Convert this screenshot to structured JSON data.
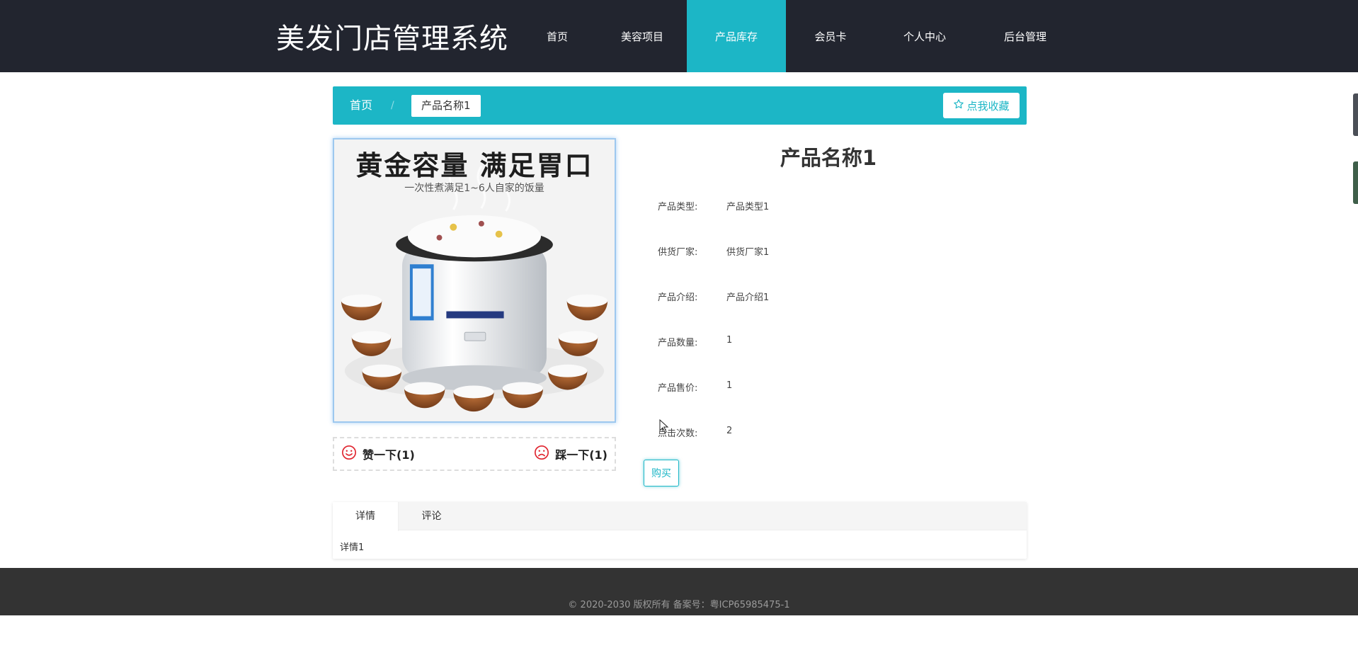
{
  "header": {
    "site_title": "美发门店管理系统",
    "nav": [
      "首页",
      "美容项目",
      "产品库存",
      "会员卡",
      "个人中心",
      "后台管理"
    ],
    "active_nav": "产品库存"
  },
  "breadcrumb": {
    "home": "首页",
    "separator": "/",
    "current": "产品名称1",
    "favorite_label": "点我收藏"
  },
  "product": {
    "image_headline": "黄金容量 满足胃口",
    "image_subline": "一次性煮满足1~6人自家的饭量",
    "title": "产品名称1",
    "fields": [
      {
        "label": "产品类型:",
        "value": "产品类型1"
      },
      {
        "label": "供货厂家:",
        "value": "供货厂家1"
      },
      {
        "label": "产品介绍:",
        "value": "产品介绍1"
      },
      {
        "label": "产品数量:",
        "value": "1"
      },
      {
        "label": "产品售价:",
        "value": "1"
      },
      {
        "label": "点击次数:",
        "value": "2"
      }
    ],
    "like_label": "赞一下(1)",
    "dislike_label": "踩一下(1)",
    "buy_label": "购买"
  },
  "tabs": {
    "items": [
      "详情",
      "评论"
    ],
    "active": "详情",
    "content": "详情1"
  },
  "footer": {
    "text": "© 2020-2030 版权所有 备案号：粤ICP65985475-1"
  },
  "colors": {
    "accent": "#1cb6c6",
    "header_bg": "#22252f",
    "footer_bg": "#333333"
  }
}
